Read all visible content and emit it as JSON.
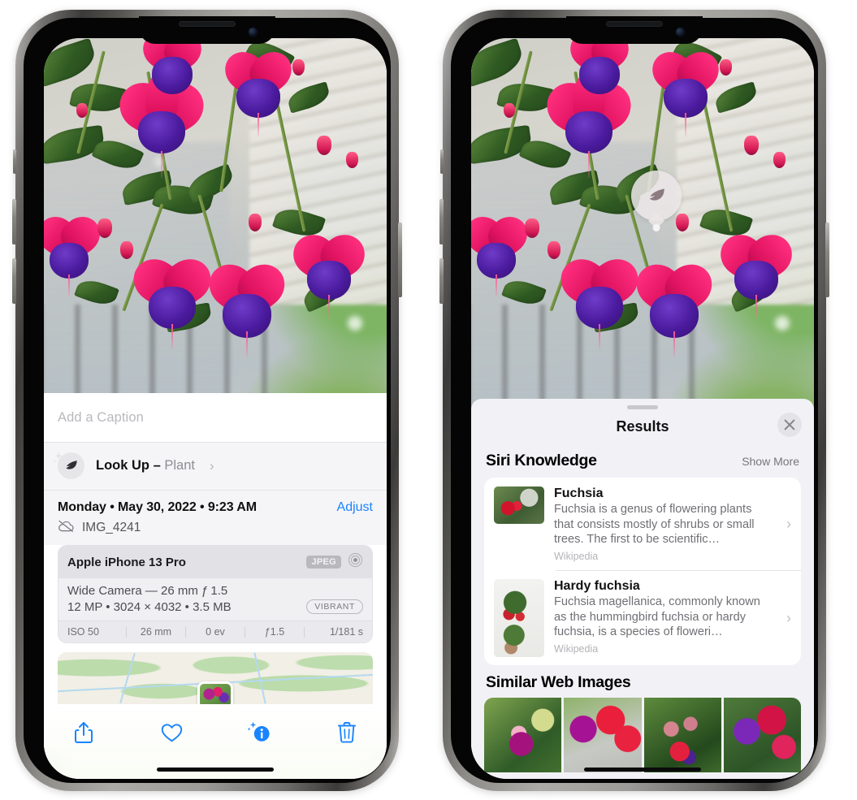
{
  "left_phone": {
    "caption": {
      "placeholder": "Add a Caption",
      "value": ""
    },
    "look_up": {
      "label_bold": "Look Up – ",
      "label_sub": "Plant",
      "icon": "leaf-icon",
      "sparkle_icon": "sparkles-icon",
      "chevron": "›"
    },
    "metadata": {
      "date_line": "Monday • May 30, 2022 • 9:23 AM",
      "adjust_label": "Adjust",
      "cloud_icon": "cloud-slash-icon",
      "filename": "IMG_4241"
    },
    "camera_card": {
      "device": "Apple iPhone 13 Pro",
      "format_badge": "JPEG",
      "lens_icon": "aperture-icon",
      "lens_line": "Wide Camera — 26 mm ƒ 1.5",
      "specs_line": "12 MP • 3024 × 4032 • 3.5 MB",
      "profile_badge": "VIBRANT",
      "exif": [
        "ISO 50",
        "26 mm",
        "0 ev",
        "ƒ1.5",
        "1/181 s"
      ]
    },
    "toolbar": {
      "share_label": "Share",
      "share_icon": "share-icon",
      "favorite_label": "Favorite",
      "favorite_icon": "heart-icon",
      "info_label": "Info",
      "info_icon": "info-sparkle-icon",
      "delete_label": "Delete",
      "delete_icon": "trash-icon",
      "accent_color": "#1a84ff"
    },
    "map": {
      "pin_label": "photo-location-pin"
    }
  },
  "right_phone": {
    "visual_look_up_badge": {
      "icon": "leaf-icon",
      "label": "Visual Look Up"
    },
    "sheet": {
      "title": "Results",
      "close_icon": "close-icon",
      "grabber": "sheet-grabber"
    },
    "siri_knowledge": {
      "title": "Siri Knowledge",
      "show_more": "Show More",
      "results": [
        {
          "title": "Fuchsia",
          "description": "Fuchsia is a genus of flowering plants that consists mostly of shrubs or small trees. The first to be scientific…",
          "source": "Wikipedia",
          "chevron": "›"
        },
        {
          "title": "Hardy fuchsia",
          "description": "Fuchsia magellanica, commonly known as the hummingbird fuchsia or hardy fuchsia, is a species of floweri…",
          "source": "Wikipedia",
          "chevron": "›"
        }
      ]
    },
    "similar_web_images": {
      "title": "Similar Web Images",
      "thumbs": [
        "web-image-1",
        "web-image-2",
        "web-image-3",
        "web-image-4"
      ]
    }
  },
  "colors": {
    "accent_blue": "#1a84ff",
    "sheet_bg": "#f2f1f6",
    "card_bg": "#ffffff",
    "secondary_text": "#8e8e93"
  }
}
